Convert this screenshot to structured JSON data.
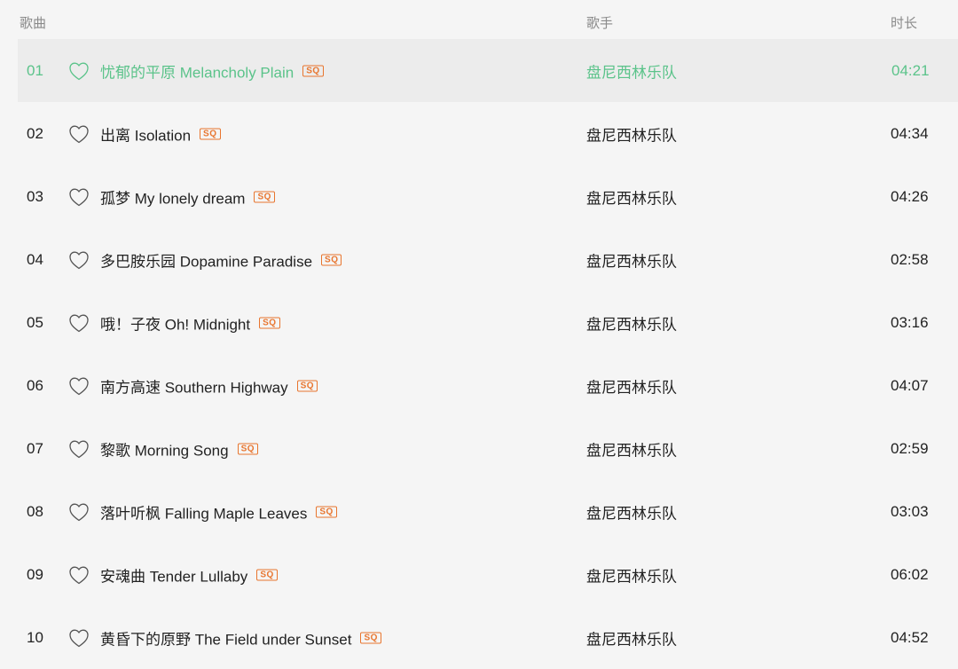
{
  "header": {
    "title": "歌曲",
    "artist": "歌手",
    "duration": "时长"
  },
  "badge": "SQ",
  "colors": {
    "playing": "#5bc38a",
    "badge": "#e8752e"
  },
  "tracks": [
    {
      "num": "01",
      "title": "忧郁的平原 Melancholy Plain",
      "artist": "盘尼西林乐队",
      "duration": "04:21",
      "playing": true
    },
    {
      "num": "02",
      "title": "出离 Isolation",
      "artist": "盘尼西林乐队",
      "duration": "04:34"
    },
    {
      "num": "03",
      "title": "孤梦 My lonely dream",
      "artist": "盘尼西林乐队",
      "duration": "04:26"
    },
    {
      "num": "04",
      "title": "多巴胺乐园 Dopamine Paradise",
      "artist": "盘尼西林乐队",
      "duration": "02:58"
    },
    {
      "num": "05",
      "title": "哦！子夜 Oh! Midnight",
      "artist": "盘尼西林乐队",
      "duration": "03:16"
    },
    {
      "num": "06",
      "title": "南方高速 Southern Highway",
      "artist": "盘尼西林乐队",
      "duration": "04:07"
    },
    {
      "num": "07",
      "title": "黎歌 Morning Song",
      "artist": "盘尼西林乐队",
      "duration": "02:59"
    },
    {
      "num": "08",
      "title": "落叶听枫 Falling Maple Leaves",
      "artist": "盘尼西林乐队",
      "duration": "03:03"
    },
    {
      "num": "09",
      "title": "安魂曲 Tender Lullaby",
      "artist": "盘尼西林乐队",
      "duration": "06:02"
    },
    {
      "num": "10",
      "title": "黄昏下的原野 The Field under Sunset",
      "artist": "盘尼西林乐队",
      "duration": "04:52"
    }
  ]
}
